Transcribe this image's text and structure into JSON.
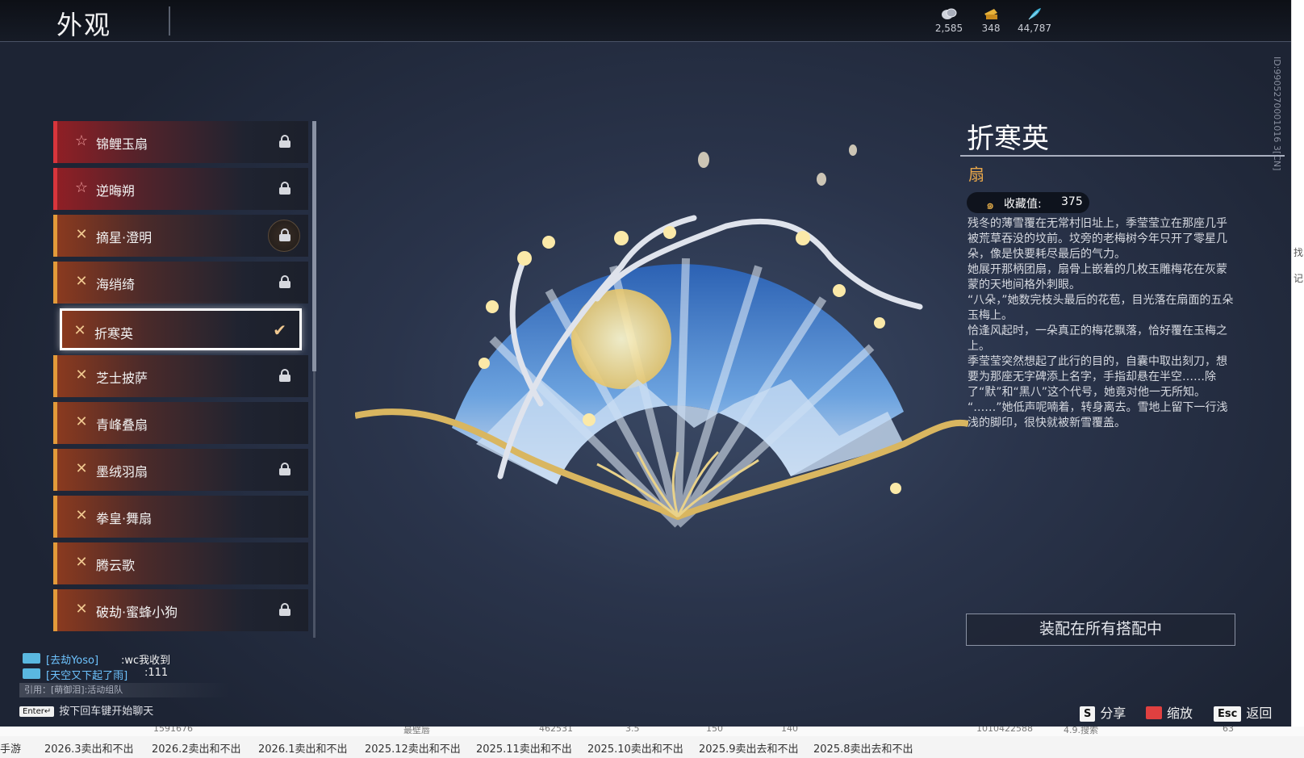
{
  "page": {
    "title": "外观",
    "id_label": "ID:9905270001016 3[CN]"
  },
  "currencies": [
    {
      "icon": "silver-coin-icon",
      "value": "2,585"
    },
    {
      "icon": "gold-ticket-icon",
      "value": "348"
    },
    {
      "icon": "feather-icon",
      "value": "44,787"
    }
  ],
  "items": [
    {
      "label": "锦鲤玉扇",
      "tier": "red",
      "locked": true
    },
    {
      "label": "逆晦朔",
      "tier": "red",
      "locked": true
    },
    {
      "label": "摘星·澄明",
      "tier": "gold",
      "locked": true
    },
    {
      "label": "海绡绮",
      "tier": "gold",
      "locked": true
    },
    {
      "label": "折寒英",
      "tier": "gold",
      "locked": false,
      "selected": true
    },
    {
      "label": "芝士披萨",
      "tier": "gold",
      "locked": true
    },
    {
      "label": "青峰叠扇",
      "tier": "gold",
      "locked": false
    },
    {
      "label": "墨绒羽扇",
      "tier": "gold",
      "locked": true
    },
    {
      "label": "拳皇·舞扇",
      "tier": "gold",
      "locked": false
    },
    {
      "label": "腾云歌",
      "tier": "gold",
      "locked": false
    },
    {
      "label": "破劫·蜜蜂小狗",
      "tier": "gold",
      "locked": true
    }
  ],
  "detail": {
    "name": "折寒英",
    "type": "扇",
    "collect_label": "收藏值:",
    "collect_value": "375",
    "lore": "残冬的薄雪覆在无常村旧址上，季莹莹立在那座几乎被荒草吞没的坟前。坟旁的老梅树今年只开了零星几朵，像是快要耗尽最后的气力。\n她展开那柄团扇，扇骨上嵌着的几枚玉雕梅花在灰蒙蒙的天地间格外刺眼。\n“八朵，”她数完枝头最后的花苞，目光落在扇面的五朵玉梅上。\n恰逢风起时，一朵真正的梅花飘落，恰好覆在玉梅之上。\n季莹莹突然想起了此行的目的，自囊中取出刻刀，想要为那座无字碑添上名字，手指却悬在半空……除了“默”和“黑八”这个代号，她竟对他一无所知。\n“……”她低声呢喃着，转身离去。雪地上留下一行浅浅的脚印，很快就被新雪覆盖。",
    "equip_button": "装配在所有搭配中"
  },
  "chat": {
    "lines": [
      {
        "name": "[去劫Yoso]",
        "msg": ":wc我收到"
      },
      {
        "name": "[天空又下起了雨]",
        "msg": ":111"
      }
    ],
    "quote": "引用：[萌御泪]:活动组队",
    "enter_key": "Enter↵",
    "enter_hint": "按下回车键开始聊天"
  },
  "hints": [
    {
      "key": "S",
      "label": "分享"
    },
    {
      "key": "book",
      "label": "缩放"
    },
    {
      "key": "Esc",
      "label": "返回"
    }
  ],
  "taskbar": {
    "lead": "手游",
    "tabs": [
      "2026.3卖出和不出",
      "2026.2卖出和不出",
      "2026.1卖出和不出",
      "2025.12卖出和不出",
      "2025.11卖出和不出",
      "2025.10卖出和不出",
      "2025.9卖出去和不出",
      "2025.8卖出去和不出"
    ],
    "bleed": [
      "1591676",
      "最壁唇",
      "462531",
      "3.5",
      "150",
      "140",
      "1010422588",
      "4.9.搜索",
      "63"
    ]
  },
  "right_edge": [
    "找",
    "记"
  ]
}
